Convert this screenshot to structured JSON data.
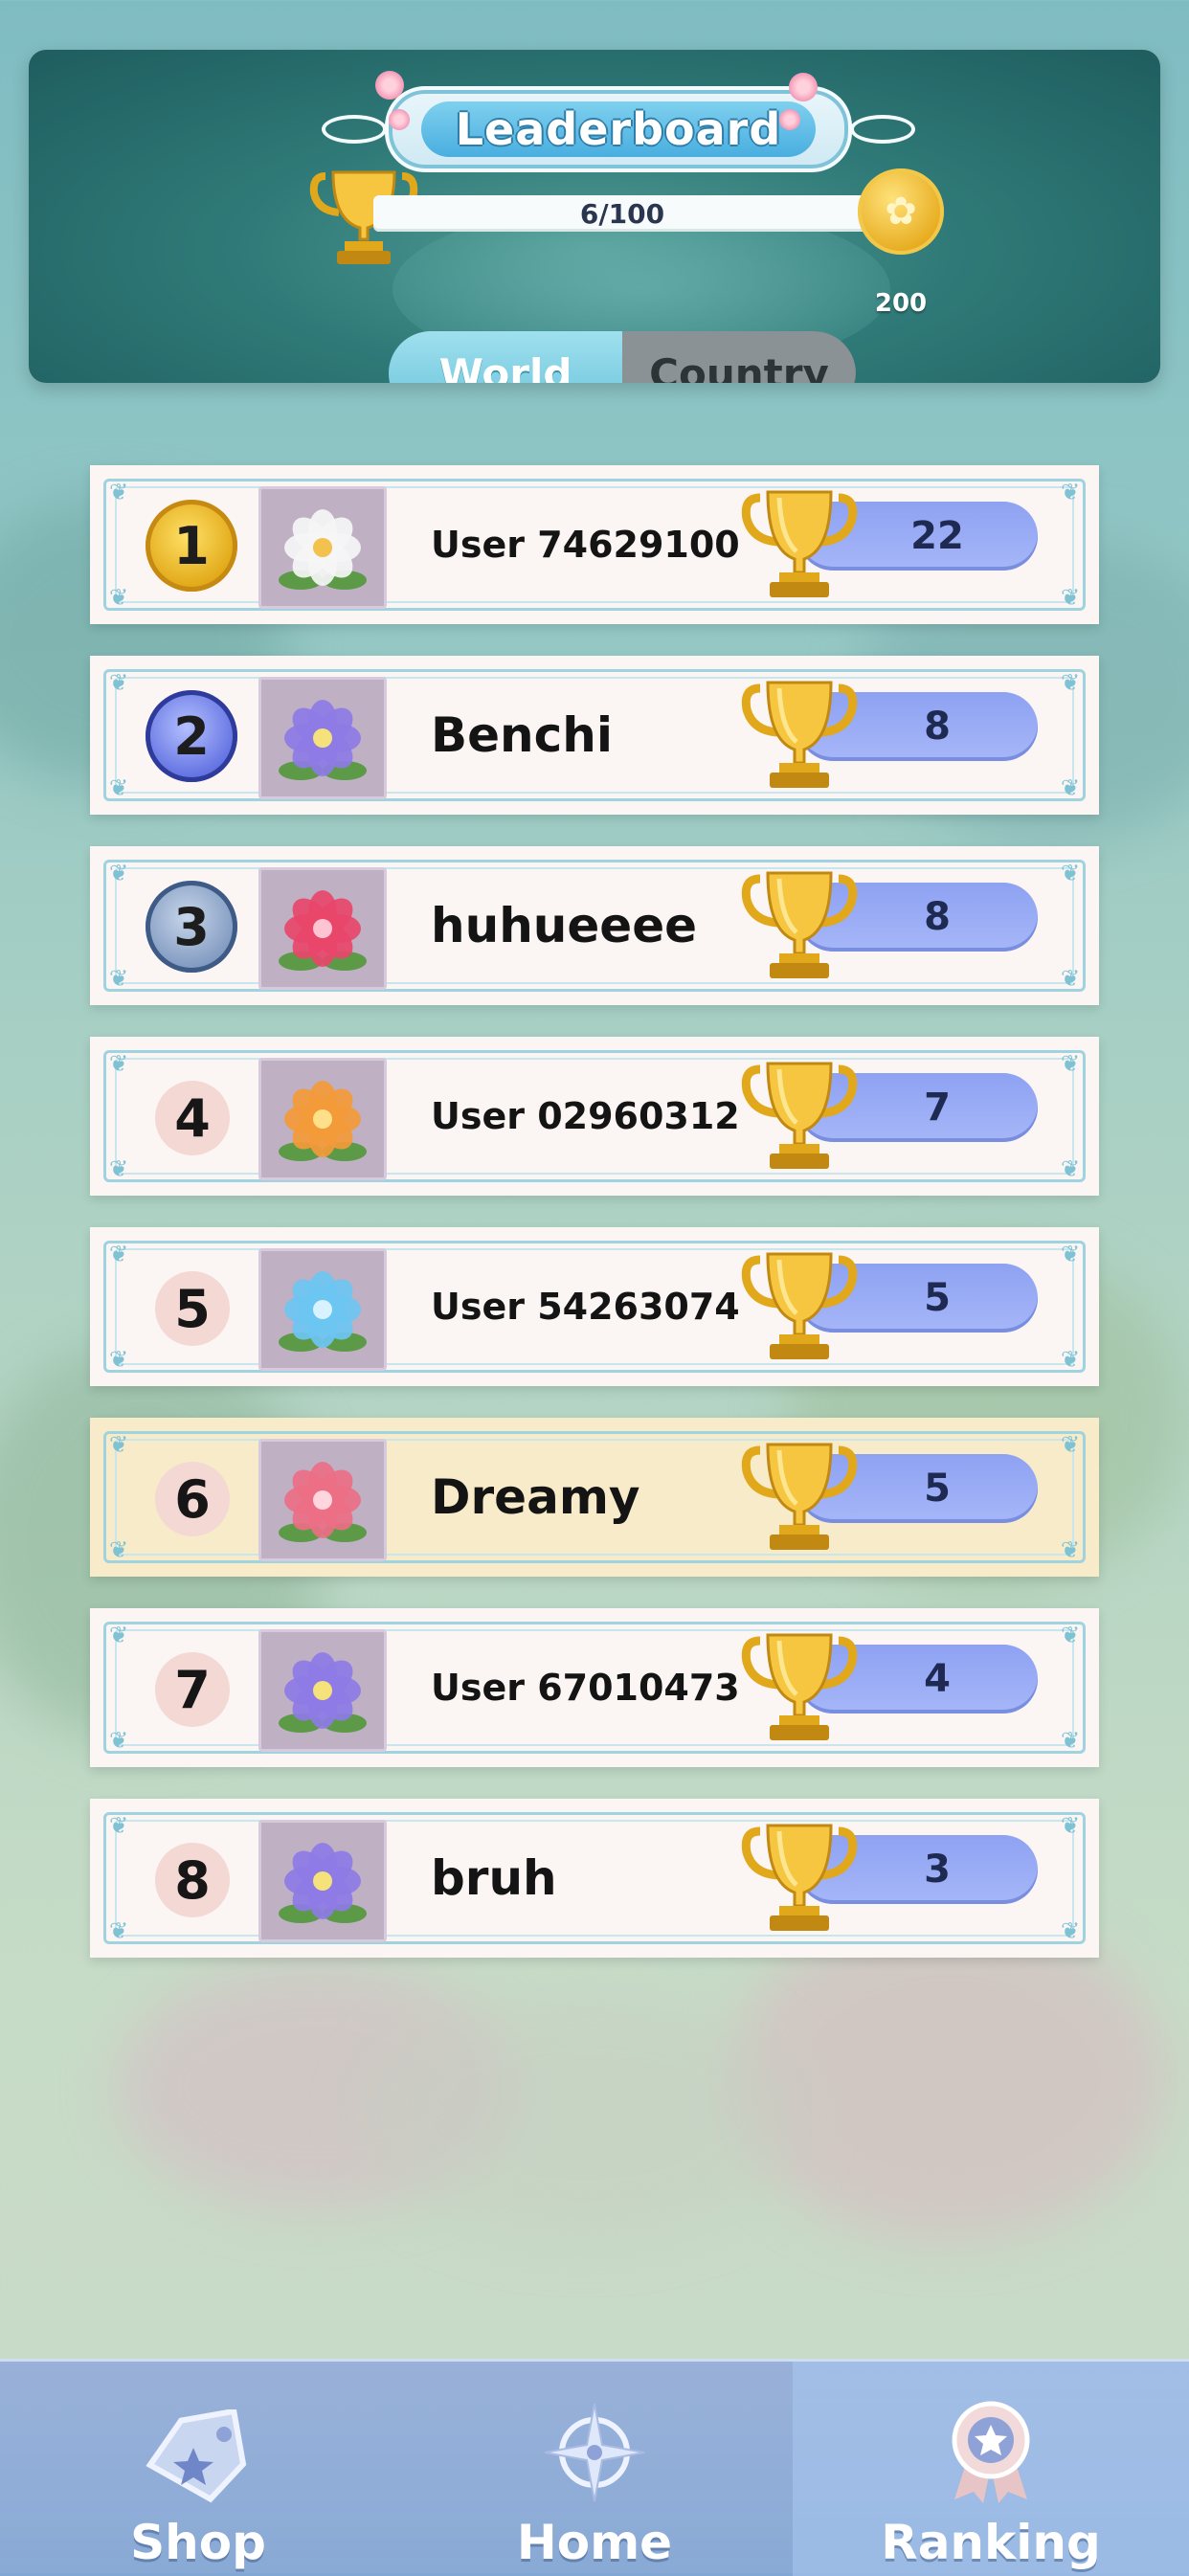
{
  "header": {
    "title": "Leaderboard",
    "progress_text": "6/100",
    "coin_count": "200",
    "tabs": [
      {
        "label": "World",
        "active": true
      },
      {
        "label": "Country",
        "active": false
      }
    ]
  },
  "leaderboard": [
    {
      "rank": "1",
      "name": "User 74629100",
      "score": "22",
      "flower": "white-flower",
      "flower_color": "#f5f5f5",
      "flower_center": "#f2c14e"
    },
    {
      "rank": "2",
      "name": "Benchi",
      "score": "8",
      "flower": "lotus",
      "flower_color": "#8e7be6",
      "flower_center": "#f6e27a"
    },
    {
      "rank": "3",
      "name": "huhueeee",
      "score": "8",
      "flower": "red-cactus-flower",
      "flower_color": "#e8466a",
      "flower_center": "#ffc4d2"
    },
    {
      "rank": "4",
      "name": "User 02960312",
      "score": "7",
      "flower": "orange-cactus-flower",
      "flower_color": "#f39a3a",
      "flower_center": "#ffe08a"
    },
    {
      "rank": "5",
      "name": "User 54263074",
      "score": "5",
      "flower": "blue-flower",
      "flower_color": "#6cc6f2",
      "flower_center": "#d8f2ff"
    },
    {
      "rank": "6",
      "name": "Dreamy",
      "score": "5",
      "flower": "pink-rose",
      "flower_color": "#ec6f86",
      "flower_center": "#ffd6de"
    },
    {
      "rank": "7",
      "name": "User 67010473",
      "score": "4",
      "flower": "lotus",
      "flower_color": "#8e7be6",
      "flower_center": "#f6e27a"
    },
    {
      "rank": "8",
      "name": "bruh",
      "score": "3",
      "flower": "lotus",
      "flower_color": "#8e7be6",
      "flower_center": "#f6e27a"
    }
  ],
  "current_user_rank": "6",
  "nav": [
    {
      "label": "Shop",
      "icon": "tag-icon",
      "active": false
    },
    {
      "label": "Home",
      "icon": "compass-icon",
      "active": false
    },
    {
      "label": "Ranking",
      "icon": "ribbon-badge-icon",
      "active": true
    }
  ],
  "colors": {
    "highlight_row": "#f8ebc9",
    "score_pill": "#8ea2f2",
    "tab_active": "#6cc4dc"
  }
}
